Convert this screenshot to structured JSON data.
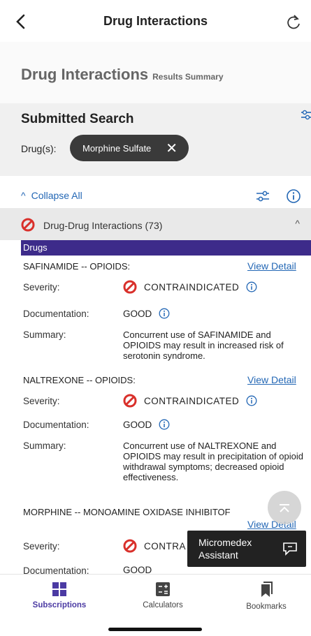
{
  "header": {
    "title": "Drug Interactions"
  },
  "results_summary": {
    "title": "Drug Interactions",
    "subtitle": "Results Summary"
  },
  "submitted_search": {
    "heading": "Submitted Search",
    "drug_label": "Drug(s):",
    "chip_label": "Morphine Sulfate"
  },
  "controls": {
    "collapse_all": "Collapse All"
  },
  "section": {
    "label": "Drug-Drug Interactions (73)",
    "category_label": "Drugs"
  },
  "interactions": [
    {
      "title": "SAFINAMIDE -- OPIOIDS:",
      "view_detail": "View Detail",
      "severity_label": "Severity:",
      "severity_value": "CONTRAINDICATED",
      "documentation_label": "Documentation:",
      "documentation_value": "GOOD",
      "summary_label": "Summary:",
      "summary": "Concurrent use of SAFINAMIDE and OPIOIDS may result in increased risk of serotonin syndrome."
    },
    {
      "title": "NALTREXONE -- OPIOIDS:",
      "view_detail": "View Detail",
      "severity_label": "Severity:",
      "severity_value": "CONTRAINDICATED",
      "documentation_label": "Documentation:",
      "documentation_value": "GOOD",
      "summary_label": "Summary:",
      "summary": "Concurrent use of NALTREXONE and OPIOIDS may result in precipitation of opioid withdrawal symptoms; decreased opioid effectiveness."
    },
    {
      "title": "MORPHINE -- MONOAMINE OXIDASE INHIBITOF",
      "view_detail": "View Detail",
      "severity_label": "Severity:",
      "severity_value": "CONTRA",
      "documentation_label": "Documentation:",
      "documentation_value": "GOOD"
    }
  ],
  "assistant": {
    "label": "Micromedex Assistant"
  },
  "bottom_nav": {
    "items": [
      {
        "label": "Subscriptions",
        "icon": "grid-icon",
        "active": true
      },
      {
        "label": "Calculators",
        "icon": "calculator-icon",
        "active": false
      },
      {
        "label": "Bookmarks",
        "icon": "bookmarks-icon",
        "active": false
      }
    ]
  },
  "colors": {
    "accent_purple": "#3d2b8a",
    "link_blue": "#2367b5",
    "contraindicated_red": "#d9302b",
    "active_nav": "#4b3aa3"
  }
}
